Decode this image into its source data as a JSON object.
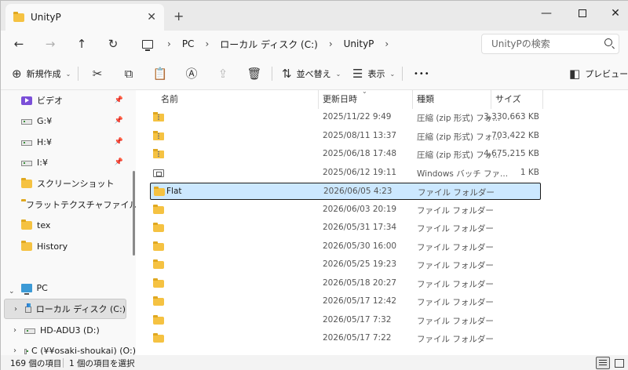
{
  "window": {
    "tab_title": "UnityP",
    "tab_close": "✕",
    "new_tab": "+",
    "minimize": "—",
    "close": "✕"
  },
  "nav": {
    "back": "←",
    "forward": "→",
    "up": "↑",
    "refresh": "↻",
    "breadcrumbs": [
      "PC",
      "ローカル ディスク (C:)",
      "UnityP"
    ],
    "search_placeholder": "UnityPの検索"
  },
  "toolbar": {
    "new_label": "新規作成",
    "sort_label": "並べ替え",
    "view_label": "表示",
    "more_label": "•••",
    "preview_label": "プレビュー",
    "icons": {
      "new": "⊕",
      "cut": "✂",
      "copy": "⧉",
      "paste": "📋",
      "rename": "Ⓐ",
      "share": "⇪",
      "delete": "🗑",
      "sort": "⇅",
      "view": "☰",
      "preview": "◧"
    }
  },
  "sidebar": {
    "items": [
      {
        "label": "ビデオ",
        "icon": "video-icon",
        "pinned": true
      },
      {
        "label": "G:¥",
        "icon": "drive-icon",
        "pinned": true
      },
      {
        "label": "H:¥",
        "icon": "drive-icon",
        "pinned": true
      },
      {
        "label": "I:¥",
        "icon": "drive-icon",
        "pinned": true
      },
      {
        "label": "スクリーンショット",
        "icon": "folder-icon",
        "pinned": false
      },
      {
        "label": "フラットテクスチャファイル",
        "icon": "folder-icon",
        "pinned": false
      },
      {
        "label": "tex",
        "icon": "folder-icon",
        "pinned": false
      },
      {
        "label": "History",
        "icon": "folder-icon",
        "pinned": false
      }
    ],
    "tree": [
      {
        "label": "PC",
        "icon": "pc-icon",
        "expander": "⌄"
      },
      {
        "label": "ローカル ディスク (C:)",
        "icon": "sysdrive-icon",
        "expander": "›"
      },
      {
        "label": "HD-ADU3 (D:)",
        "icon": "drive-icon",
        "expander": "›"
      },
      {
        "label": "C (¥¥osaki-shoukai) (O:)",
        "icon": "netdrive-icon",
        "expander": "›"
      }
    ]
  },
  "columns": {
    "name": "名前",
    "date": "更新日時",
    "type": "種類",
    "size": "サイズ"
  },
  "files": [
    {
      "name": "",
      "icon": "zip-icon",
      "date": "2025/11/22 9:49",
      "type": "圧縮 (zip 形式) フォ...",
      "size": "3,330,663 KB"
    },
    {
      "name": "",
      "icon": "zip-icon",
      "date": "2025/08/11 13:37",
      "type": "圧縮 (zip 形式) フォ...",
      "size": "703,422 KB"
    },
    {
      "name": "",
      "icon": "zip-icon",
      "date": "2025/06/18 17:48",
      "type": "圧縮 (zip 形式) フォ...",
      "size": "4,675,215 KB"
    },
    {
      "name": "",
      "icon": "batch-icon",
      "date": "2025/06/12 19:11",
      "type": "Windows バッチ ファ...",
      "size": "1 KB"
    },
    {
      "name": "Flat",
      "icon": "folder-icon",
      "date": "2026/06/05 4:23",
      "type": "ファイル フォルダー",
      "size": "",
      "selected": true
    },
    {
      "name": "",
      "icon": "folder-icon",
      "date": "2026/06/03 20:19",
      "type": "ファイル フォルダー",
      "size": ""
    },
    {
      "name": "",
      "icon": "folder-icon",
      "date": "2026/05/31 17:34",
      "type": "ファイル フォルダー",
      "size": ""
    },
    {
      "name": "",
      "icon": "folder-icon",
      "date": "2026/05/30 16:00",
      "type": "ファイル フォルダー",
      "size": ""
    },
    {
      "name": "",
      "icon": "folder-icon",
      "date": "2026/05/25 19:23",
      "type": "ファイル フォルダー",
      "size": ""
    },
    {
      "name": "",
      "icon": "folder-icon",
      "date": "2026/05/18 20:27",
      "type": "ファイル フォルダー",
      "size": ""
    },
    {
      "name": "",
      "icon": "folder-icon",
      "date": "2026/05/17 12:42",
      "type": "ファイル フォルダー",
      "size": ""
    },
    {
      "name": "",
      "icon": "folder-icon",
      "date": "2026/05/17 7:32",
      "type": "ファイル フォルダー",
      "size": ""
    },
    {
      "name": "",
      "icon": "folder-icon",
      "date": "2026/05/17 7:22",
      "type": "ファイル フォルダー",
      "size": ""
    }
  ],
  "status": {
    "count": "169 個の項目",
    "selected": "1 個の項目を選択"
  },
  "colors": {
    "selection": "#cce8ff",
    "folder": "#f5c242",
    "background": "#f3f3f3"
  }
}
